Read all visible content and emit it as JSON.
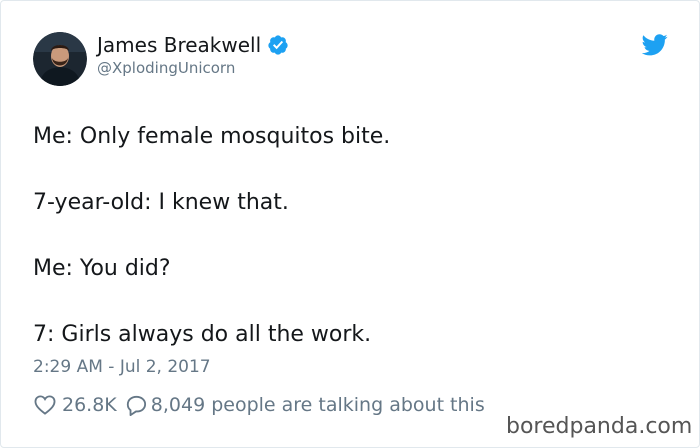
{
  "author": {
    "name": "James Breakwell",
    "handle": "@XplodingUnicorn"
  },
  "tweet": {
    "lines": [
      "Me: Only female mosquitos bite.",
      "7-year-old: I knew that.",
      "Me: You did?",
      "7: Girls always do all the work."
    ],
    "timestamp": "2:29 AM - Jul 2, 2017"
  },
  "actions": {
    "likes": "26.8K",
    "replies": "8,049 people are talking about this"
  },
  "watermark": "boredpanda.com",
  "icons": [
    "verified-badge-icon",
    "twitter-bird-icon",
    "heart-icon",
    "reply-icon"
  ],
  "colors": {
    "brand_blue": "#1da1f2",
    "text_primary": "#14171a",
    "text_secondary": "#657786",
    "border": "#e1e8ed"
  }
}
